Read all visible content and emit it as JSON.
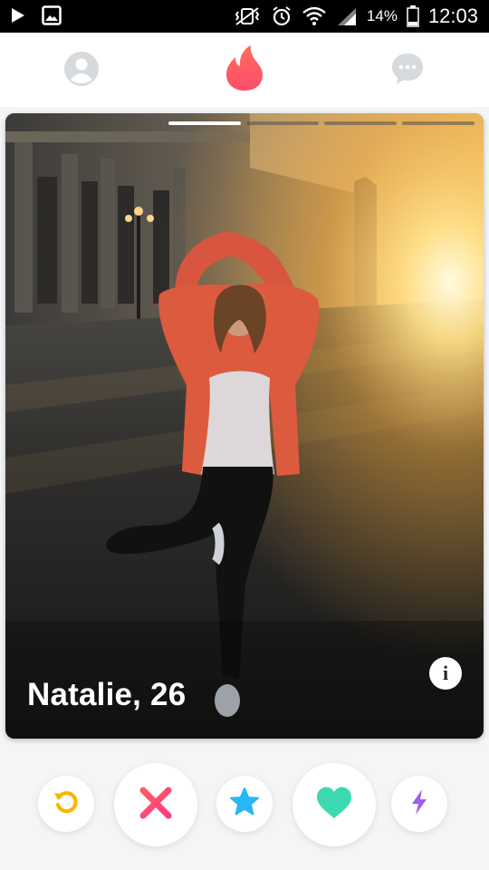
{
  "status_bar": {
    "battery": "14%",
    "time": "12:03",
    "icons": [
      "play-icon",
      "image-icon",
      "vibrate-mute-icon",
      "alarm-icon",
      "wifi-icon",
      "signal-icon",
      "battery-icon"
    ]
  },
  "top_nav": {
    "profile_icon": "profile-icon",
    "app_icon": "flame-icon",
    "chat_icon": "chat-icon",
    "accent": "#fd5068"
  },
  "card": {
    "name_age": "Natalie, 26",
    "photo_count": 4,
    "active_photo": 1,
    "info_label": "i"
  },
  "actions": {
    "rewind": {
      "icon": "rewind-icon",
      "color": "#f5b800"
    },
    "nope": {
      "icon": "close-icon",
      "color": "#fd4e6a"
    },
    "super_like": {
      "icon": "star-icon",
      "color": "#28b6f6"
    },
    "like": {
      "icon": "heart-icon",
      "color": "#3cd9b1"
    },
    "boost": {
      "icon": "lightning-icon",
      "color": "#a35ee8"
    }
  }
}
